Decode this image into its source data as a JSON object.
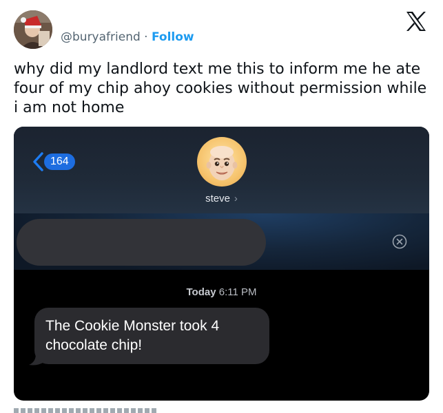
{
  "tweet": {
    "handle": "@buryafriend",
    "separator": "·",
    "follow_label": "Follow",
    "text": "why did my landlord text me this to inform me he ate four of my chip ahoy cookies without permission while i am not home"
  },
  "icons": {
    "x_logo": "x-logo-icon",
    "back": "chevron-left-icon",
    "clear": "clear-circle-x-icon"
  },
  "screenshot": {
    "back_count": "164",
    "contact_name": "steve",
    "contact_chevron": "›",
    "timestamp_day": "Today",
    "timestamp_time": "6:11 PM",
    "message": "The Cookie Monster took 4 chocolate chip!"
  },
  "colors": {
    "follow": "#1d9bf0",
    "handle": "#536471",
    "imessage_badge": "#1d6de0",
    "bubble": "#2b2b2f"
  }
}
